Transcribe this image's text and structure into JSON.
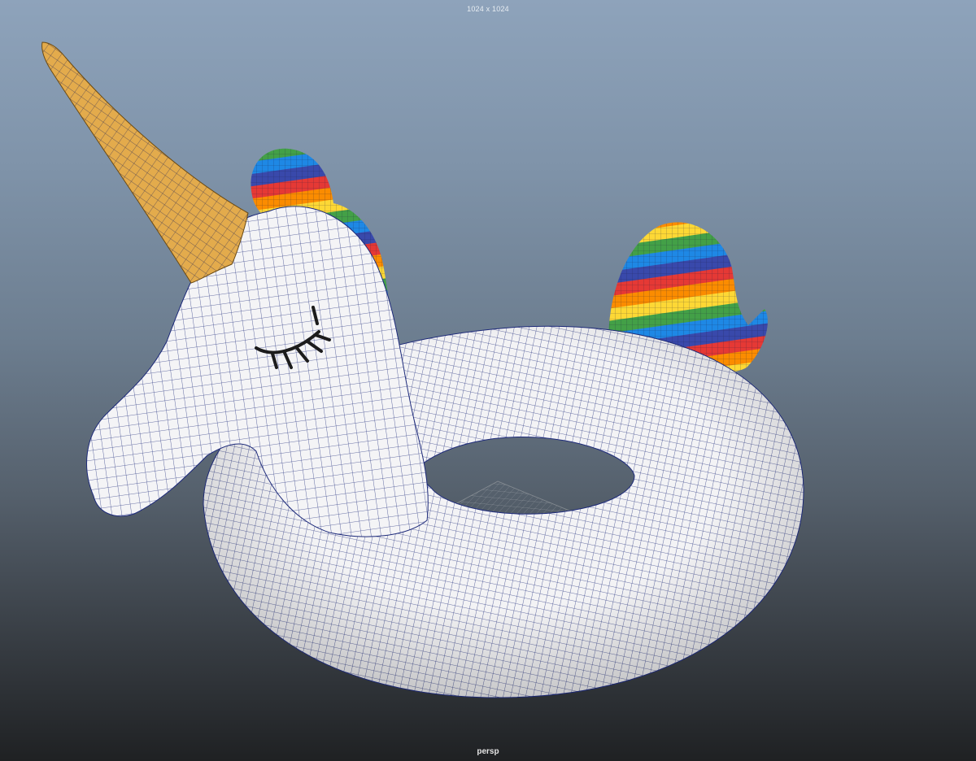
{
  "viewport": {
    "resolution_text": "1024 x 1024",
    "camera_name": "persp"
  },
  "model": {
    "icons": [
      "unicorn-float-model",
      "grid-floor"
    ],
    "colors": {
      "body": "#f3f3f5",
      "wireframe": "#1d2a7a",
      "horn": "#e3ab4c",
      "eyelash": "#1c1c1c",
      "rainbow": [
        "#e53935",
        "#fb8c00",
        "#fdd835",
        "#43a047",
        "#1e88e5",
        "#3949ab"
      ]
    }
  }
}
